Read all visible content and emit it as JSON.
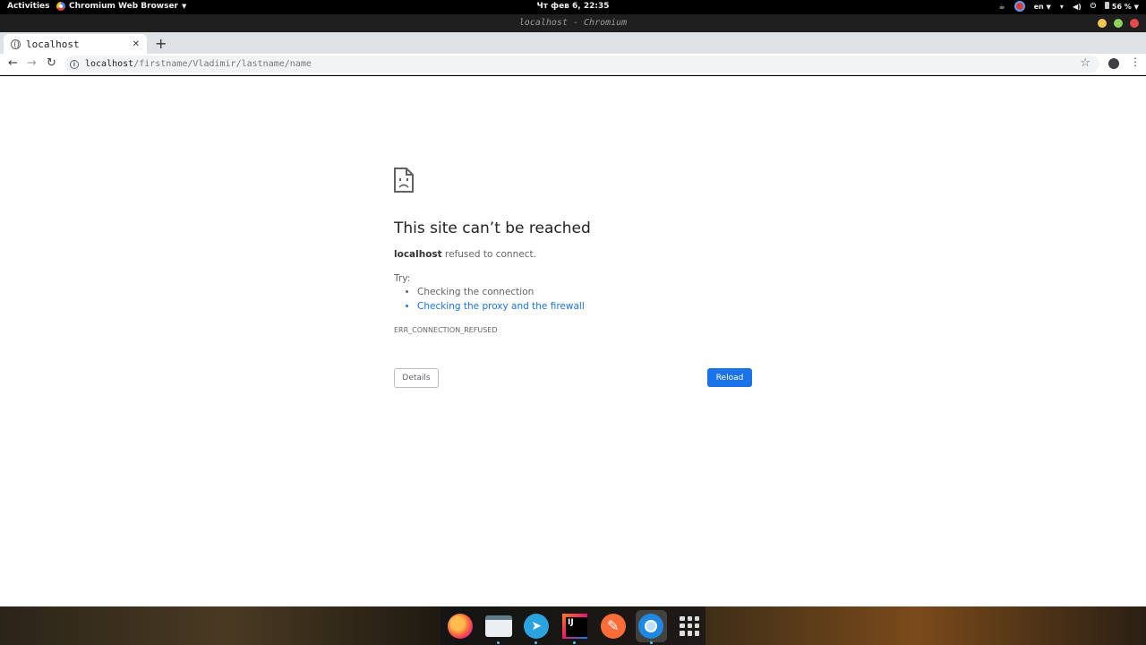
{
  "system_bar": {
    "activities": "Activities",
    "app_name": "Chromium Web Browser",
    "clock": "Чт фев  6, 22:35",
    "lang": "en",
    "battery": "56 %"
  },
  "window": {
    "title": "localhost - Chromium",
    "buttons": {
      "minimize_color": "#f5c451",
      "maximize_color": "#8fd35a",
      "close_color": "#e5484d"
    }
  },
  "tabs": [
    {
      "label": "localhost",
      "icon": "globe-icon"
    }
  ],
  "address_bar": {
    "host": "localhost",
    "path": "/firstname/Vladimir/lastname/name"
  },
  "error_page": {
    "heading": "This site can’t be reached",
    "host": "localhost",
    "message_suffix": " refused to connect.",
    "try_label": "Try:",
    "suggestions": [
      "Checking the connection",
      "Checking the proxy and the firewall"
    ],
    "error_code": "ERR_CONNECTION_REFUSED",
    "details_button": "Details",
    "reload_button": "Reload",
    "accent_color": "#1a73e8"
  },
  "dock": {
    "apps": [
      "firefox-icon",
      "files-icon",
      "telegram-icon",
      "intellij-idea-icon",
      "postman-icon",
      "chromium-icon",
      "app-grid-icon"
    ]
  }
}
